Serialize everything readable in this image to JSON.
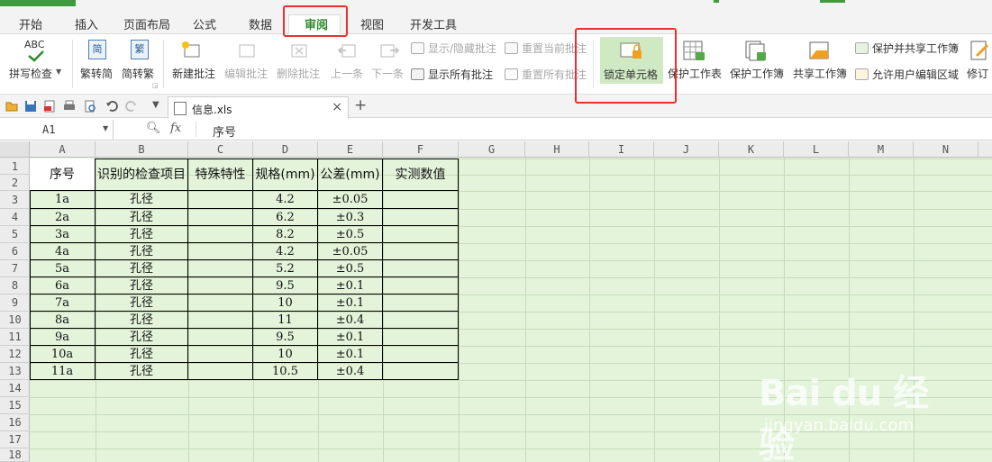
{
  "menu": {
    "tabs": [
      {
        "label": "开始"
      },
      {
        "label": "插入"
      },
      {
        "label": "页面布局"
      },
      {
        "label": "公式"
      },
      {
        "label": "数据"
      },
      {
        "label": "审阅"
      },
      {
        "label": "视图"
      },
      {
        "label": "开发工具"
      }
    ],
    "active_tab": "审阅",
    "accent_color": "#2e8b2e"
  },
  "ribbon": {
    "spell_check": "拼写检查",
    "spell_icon_text": "ABC",
    "trad_to_simp": "繁转简",
    "simp_to_trad": "简转繁",
    "simp_icon_text": "简",
    "trad_icon_text": "繁",
    "new_comment": "新建批注",
    "edit_comment": "编辑批注",
    "delete_comment": "删除批注",
    "prev": "上一条",
    "next": "下一条",
    "show_hide_comment": "显示/隐藏批注",
    "show_all_comments": "显示所有批注",
    "reset_current_comment": "重置当前批注",
    "reset_all_comments": "重置所有批注",
    "lock_cell": "锁定单元格",
    "protect_sheet": "保护工作表",
    "protect_workbook": "保护工作簿",
    "share_workbook": "共享工作簿",
    "protect_and_share": "保护并共享工作簿",
    "allow_users_edit": "允许用户编辑区域",
    "revise": "修订"
  },
  "document": {
    "tab_name": "信息.xls",
    "close_symbol": "×",
    "new_tab_symbol": "+"
  },
  "formula_bar": {
    "cell_ref": "A1",
    "fx_label": "fx",
    "content": "序号"
  },
  "sheet": {
    "columns": [
      "A",
      "B",
      "C",
      "D",
      "E",
      "F",
      "G",
      "H",
      "I",
      "J",
      "K",
      "L",
      "M",
      "N"
    ],
    "rows": [
      "1",
      "2",
      "3",
      "4",
      "5",
      "6",
      "7",
      "8",
      "9",
      "10",
      "11",
      "12",
      "13",
      "14",
      "15",
      "16",
      "17",
      "18"
    ],
    "headers": [
      "序号",
      "识别的检查项目",
      "特殊特性",
      "规格(mm)",
      "公差(mm)",
      "实测数值"
    ],
    "data": [
      [
        "1a",
        "孔径",
        "",
        "4.2",
        "±0.05",
        ""
      ],
      [
        "2a",
        "孔径",
        "",
        "6.2",
        "±0.3",
        ""
      ],
      [
        "3a",
        "孔径",
        "",
        "8.2",
        "±0.5",
        ""
      ],
      [
        "4a",
        "孔径",
        "",
        "4.2",
        "±0.05",
        ""
      ],
      [
        "5a",
        "孔径",
        "",
        "5.2",
        "±0.5",
        ""
      ],
      [
        "6a",
        "孔径",
        "",
        "9.5",
        "±0.1",
        ""
      ],
      [
        "7a",
        "孔径",
        "",
        "10",
        "±0.1",
        ""
      ],
      [
        "8a",
        "孔径",
        "",
        "11",
        "±0.4",
        ""
      ],
      [
        "9a",
        "孔径",
        "",
        "9.5",
        "±0.1",
        ""
      ],
      [
        "10a",
        "孔径",
        "",
        "10",
        "±0.1",
        ""
      ],
      [
        "11a",
        "孔径",
        "",
        "10.5",
        "±0.4",
        ""
      ]
    ],
    "fill_color": "#e3f4da"
  },
  "watermark": {
    "brand": "Bai du 经验",
    "url": "jingyan.baidu.com"
  }
}
